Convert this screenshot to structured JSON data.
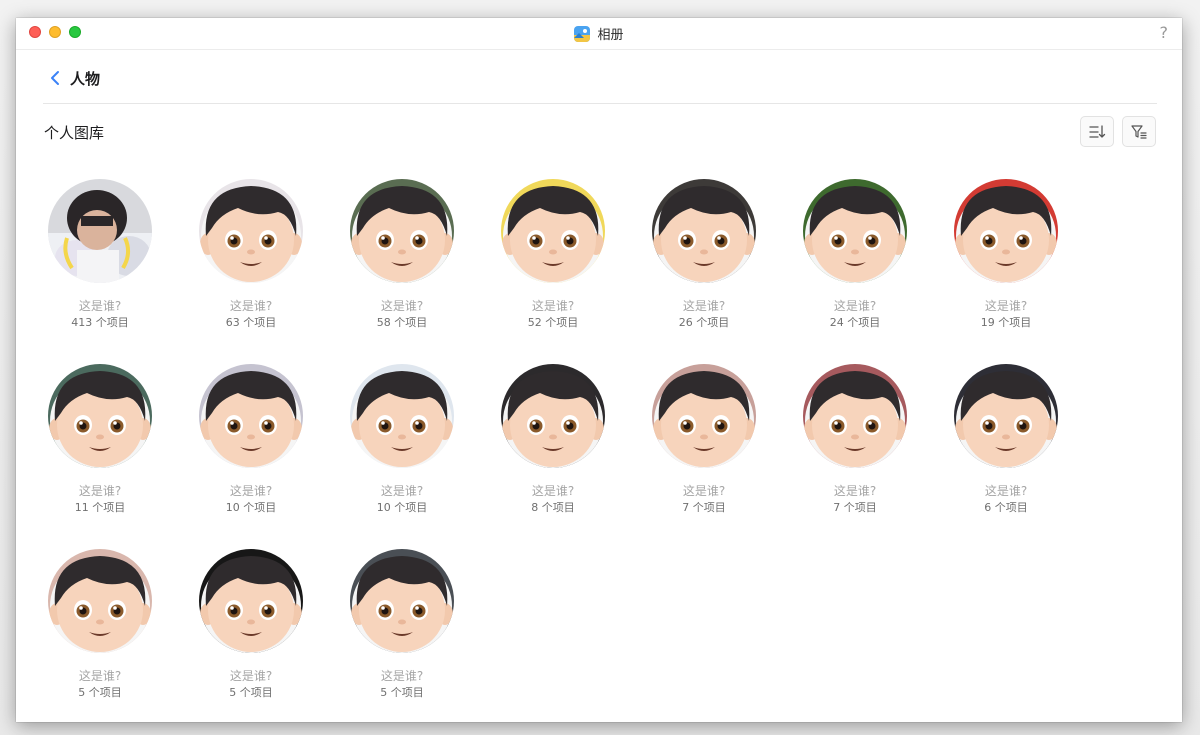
{
  "window": {
    "title": "相册",
    "help": "?"
  },
  "nav": {
    "title": "人物"
  },
  "section": {
    "title": "个人图库"
  },
  "colors": {
    "accent": "#3a82f7",
    "name_text": "#a6a6a6",
    "count_text": "#707070"
  },
  "people": [
    {
      "name": "这是谁?",
      "count": "413 个项目",
      "bg": "#c9c9c9",
      "photo": true
    },
    {
      "name": "这是谁?",
      "count": "63 个项目",
      "bg": "#e8e4e8"
    },
    {
      "name": "这是谁?",
      "count": "58 个项目",
      "bg": "#5a6d52"
    },
    {
      "name": "这是谁?",
      "count": "52 个项目",
      "bg": "#f0d85a"
    },
    {
      "name": "这是谁?",
      "count": "26 个项目",
      "bg": "#3d3a38"
    },
    {
      "name": "这是谁?",
      "count": "24 个项目",
      "bg": "#3e6a2e"
    },
    {
      "name": "这是谁?",
      "count": "19 个项目",
      "bg": "#d33b33"
    },
    {
      "name": "这是谁?",
      "count": "11 个项目",
      "bg": "#4b6a5e"
    },
    {
      "name": "这是谁?",
      "count": "10 个项目",
      "bg": "#c5c3d0"
    },
    {
      "name": "这是谁?",
      "count": "10 个项目",
      "bg": "#dfe6ee"
    },
    {
      "name": "这是谁?",
      "count": "8 个项目",
      "bg": "#2c2a2c"
    },
    {
      "name": "这是谁?",
      "count": "7 个项目",
      "bg": "#c7a09a"
    },
    {
      "name": "这是谁?",
      "count": "7 个项目",
      "bg": "#a65a5e"
    },
    {
      "name": "这是谁?",
      "count": "6 个项目",
      "bg": "#2e2e36"
    },
    {
      "name": "这是谁?",
      "count": "5 个项目",
      "bg": "#d9b7ad"
    },
    {
      "name": "这是谁?",
      "count": "5 个项目",
      "bg": "#171717"
    },
    {
      "name": "这是谁?",
      "count": "5 个项目",
      "bg": "#4a4f55"
    }
  ]
}
